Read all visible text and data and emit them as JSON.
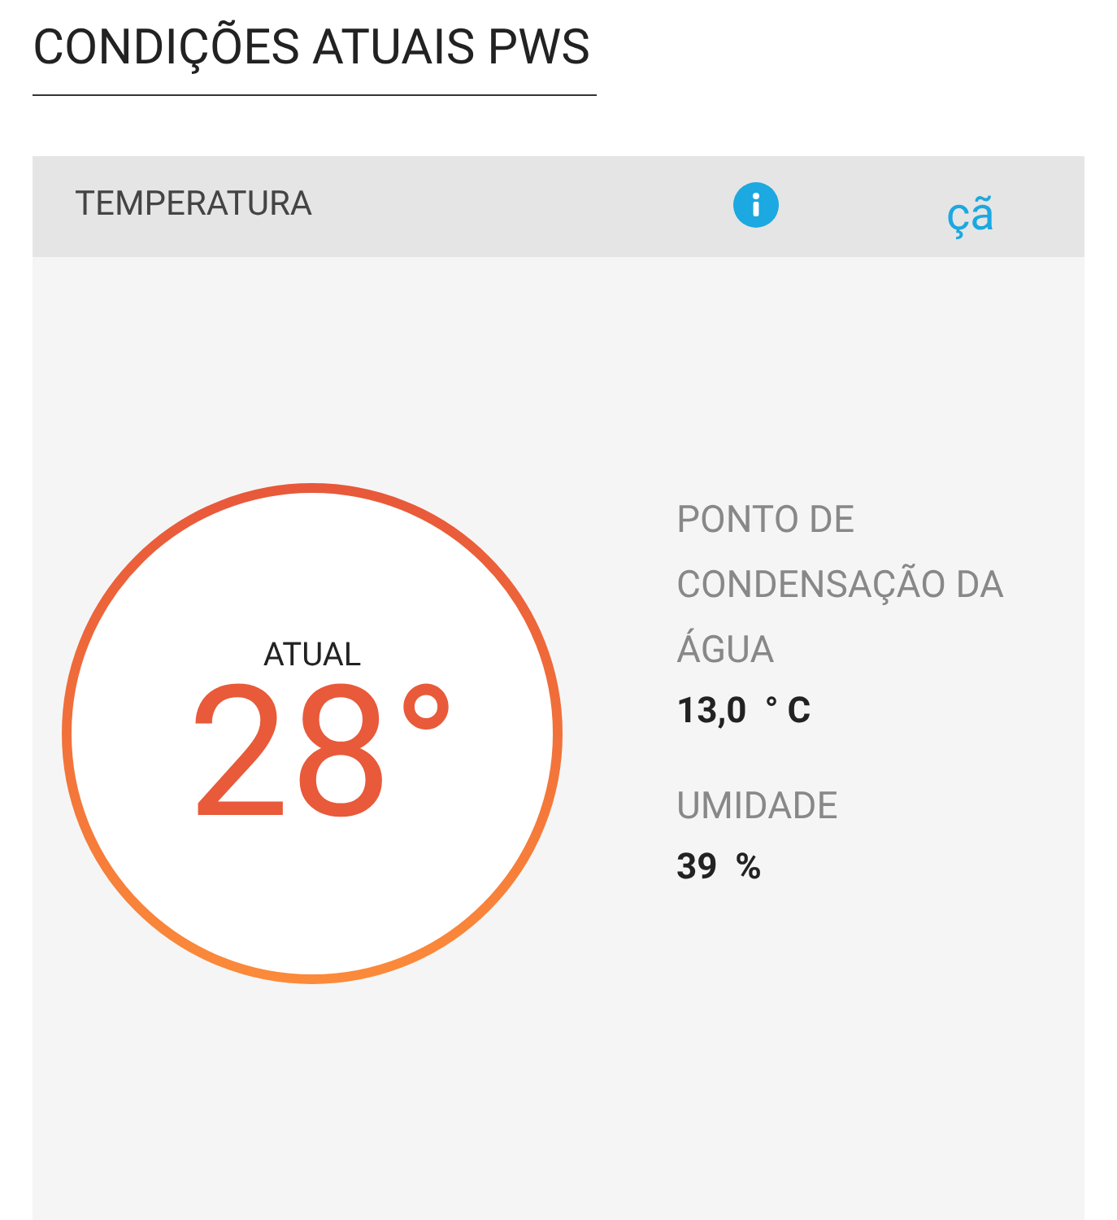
{
  "title": "CONDIÇÕES ATUAIS PWS",
  "card": {
    "header": "TEMPERATURA",
    "header_glyph": "çã",
    "gauge": {
      "label": "ATUAL",
      "value": "28°"
    },
    "readings": [
      {
        "label": "PONTO DE CONDENSAÇÃO DA ÁGUA",
        "value": "13,0  ° C"
      },
      {
        "label": "UMIDADE",
        "value": "39  %"
      }
    ]
  }
}
